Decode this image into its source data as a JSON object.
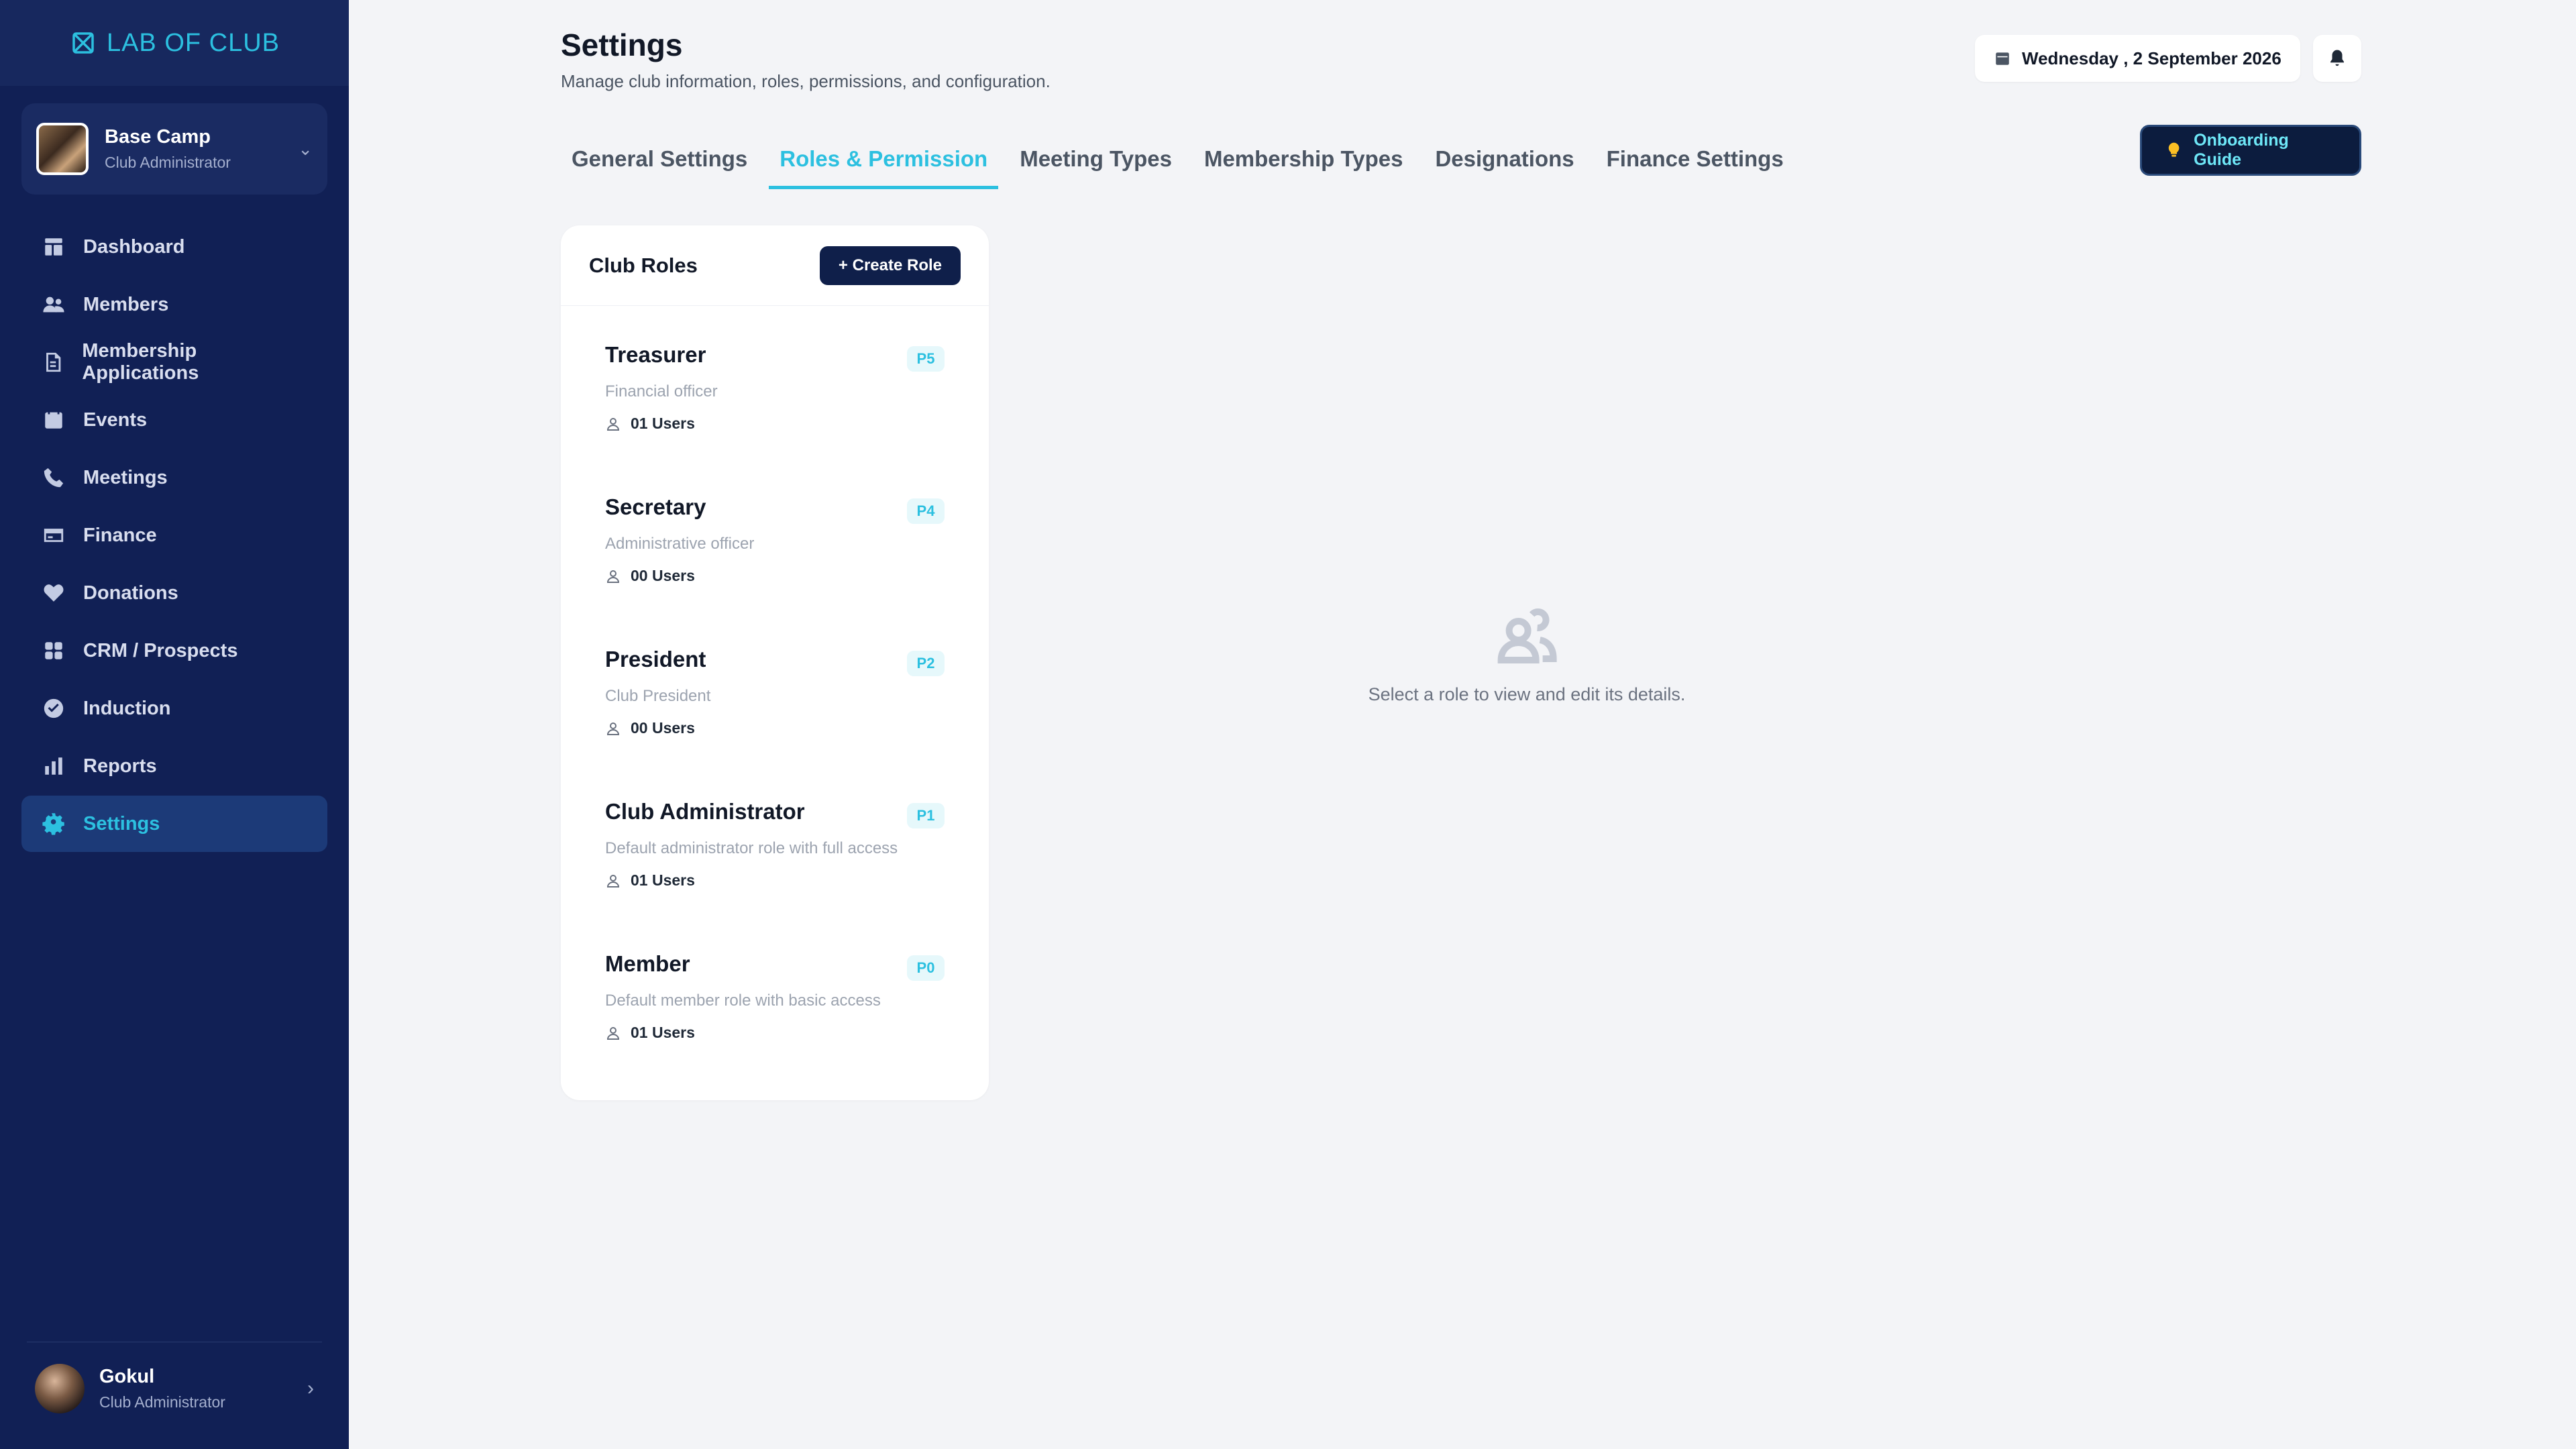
{
  "brand": {
    "name": "LAB OF CLUB"
  },
  "club": {
    "name": "Base Camp",
    "role": "Club Administrator"
  },
  "nav": [
    {
      "label": "Dashboard",
      "icon": "dashboard-icon"
    },
    {
      "label": "Members",
      "icon": "users-icon"
    },
    {
      "label": "Membership Applications",
      "icon": "document-icon"
    },
    {
      "label": "Events",
      "icon": "calendar-icon"
    },
    {
      "label": "Meetings",
      "icon": "phone-icon"
    },
    {
      "label": "Finance",
      "icon": "credit-card-icon"
    },
    {
      "label": "Donations",
      "icon": "heart-icon"
    },
    {
      "label": "CRM / Prospects",
      "icon": "grid-icon"
    },
    {
      "label": "Induction",
      "icon": "check-circle-icon"
    },
    {
      "label": "Reports",
      "icon": "bar-chart-icon"
    },
    {
      "label": "Settings",
      "icon": "gear-icon"
    }
  ],
  "user": {
    "name": "Gokul",
    "role": "Club Administrator"
  },
  "header": {
    "title": "Settings",
    "subtitle": "Manage club information, roles, permissions, and configuration.",
    "date": "Wednesday , 2 September 2026"
  },
  "tabs": [
    {
      "label": "General Settings"
    },
    {
      "label": "Roles & Permission"
    },
    {
      "label": "Meeting Types"
    },
    {
      "label": "Membership Types"
    },
    {
      "label": "Designations"
    },
    {
      "label": "Finance Settings"
    }
  ],
  "guide": {
    "label": "Onboarding Guide"
  },
  "roles_panel": {
    "title": "Club Roles",
    "create_label": "+ Create Role",
    "roles": [
      {
        "name": "Treasurer",
        "desc": "Financial officer",
        "users": "01 Users",
        "badge": "P5"
      },
      {
        "name": "Secretary",
        "desc": "Administrative officer",
        "users": "00 Users",
        "badge": "P4"
      },
      {
        "name": "President",
        "desc": "Club President",
        "users": "00 Users",
        "badge": "P2"
      },
      {
        "name": "Club Administrator",
        "desc": "Default administrator role with full access",
        "users": "01 Users",
        "badge": "P1"
      },
      {
        "name": "Member",
        "desc": "Default member role with basic access",
        "users": "01 Users",
        "badge": "P0"
      }
    ]
  },
  "empty_state": {
    "text": "Select a role to view and edit its details."
  },
  "colors": {
    "sidebar": "#112055",
    "accent": "#2cc0e0",
    "primary_button": "#0f1f4a"
  }
}
